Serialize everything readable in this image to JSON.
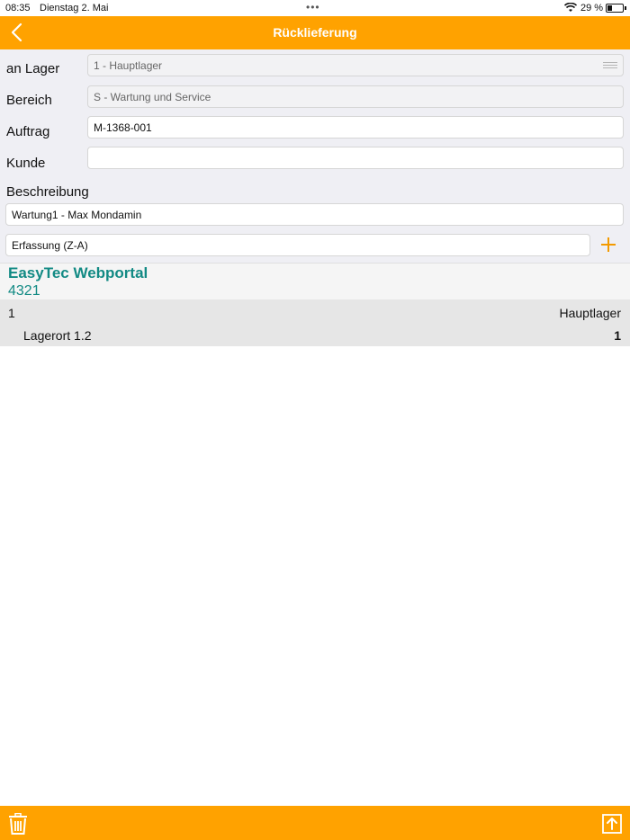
{
  "status_bar": {
    "time": "08:35",
    "date": "Dienstag 2. Mai",
    "battery": "29 %",
    "dots": "•••"
  },
  "nav": {
    "title": "Rücklieferung",
    "back_icon": "chevron-left-icon",
    "color": "#ffa200"
  },
  "form": {
    "lager_label": "an Lager",
    "lager_value": "1 - Hauptlager",
    "bereich_label": "Bereich",
    "bereich_value": "S - Wartung und Service",
    "auftrag_label": "Auftrag",
    "auftrag_value": "M-1368-001",
    "kunde_label": "Kunde",
    "kunde_value": "",
    "beschreibung_label": "Beschreibung",
    "beschreibung_value": "Wartung1 - Max Mondamin",
    "erfassung_value": "Erfassung (Z-A)",
    "add_icon": "plus-icon"
  },
  "section": {
    "name": "EasyTec Webportal",
    "number": "4321",
    "accent": "#128a84"
  },
  "items": [
    {
      "position": "1",
      "lager": "Hauptlager",
      "lagerort": "Lagerort 1.2",
      "quantity": "1"
    }
  ],
  "footer": {
    "delete_icon": "trash-icon",
    "upload_icon": "upload-icon"
  }
}
